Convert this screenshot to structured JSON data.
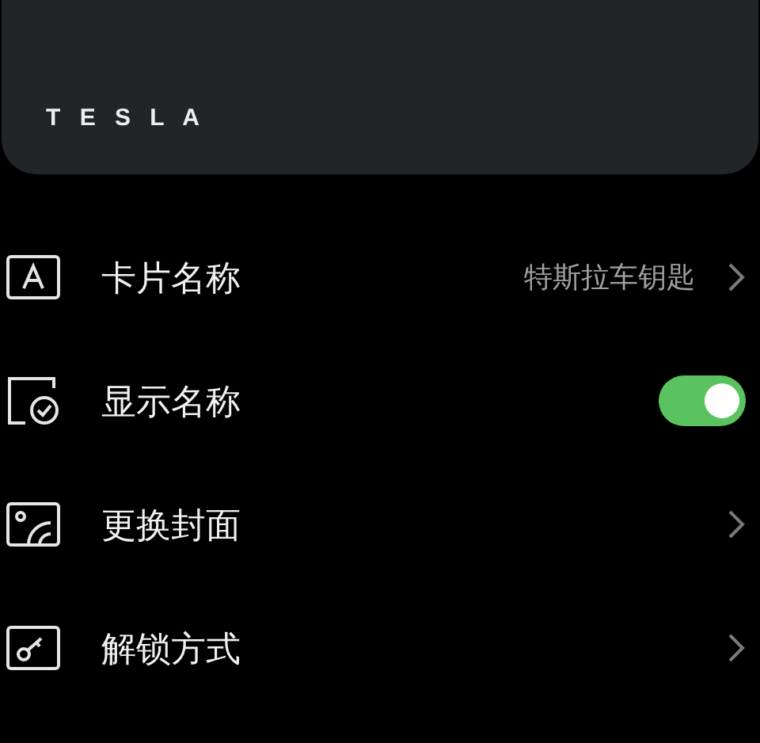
{
  "card": {
    "brand": "T E S L A"
  },
  "settings": [
    {
      "kind": "link",
      "label": "卡片名称",
      "value": "特斯拉车钥匙"
    },
    {
      "kind": "toggle",
      "label": "显示名称",
      "on": true
    },
    {
      "kind": "link",
      "label": "更换封面"
    },
    {
      "kind": "link",
      "label": "解锁方式"
    }
  ]
}
